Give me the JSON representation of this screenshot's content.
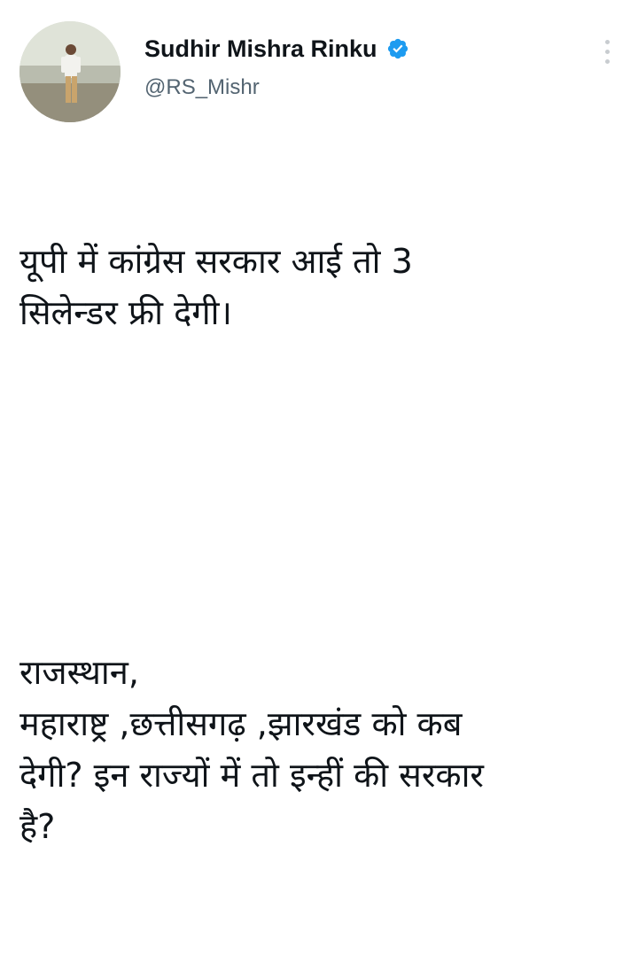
{
  "tweet": {
    "author": {
      "name": "Sudhir Mishra Rinku",
      "handle": "@RS_Mishr",
      "verified": true
    },
    "text": {
      "paragraph1": "यूपी में कांग्रेस सरकार आई तो 3\nसिलेन्डर फ्री देगी।",
      "paragraph2": "राजस्थान,\nमहाराष्ट्र ,छत्तीसगढ़ ,झारखंड को कब\nदेगी? इन राज्यों में तो इन्हीं की सरकार\nहै?"
    }
  },
  "icons": {
    "verified": "verified-badge-icon",
    "more": "more-options-icon"
  },
  "colors": {
    "verified": "#1d9bf0",
    "text": "#0f1419",
    "muted": "#536471"
  }
}
